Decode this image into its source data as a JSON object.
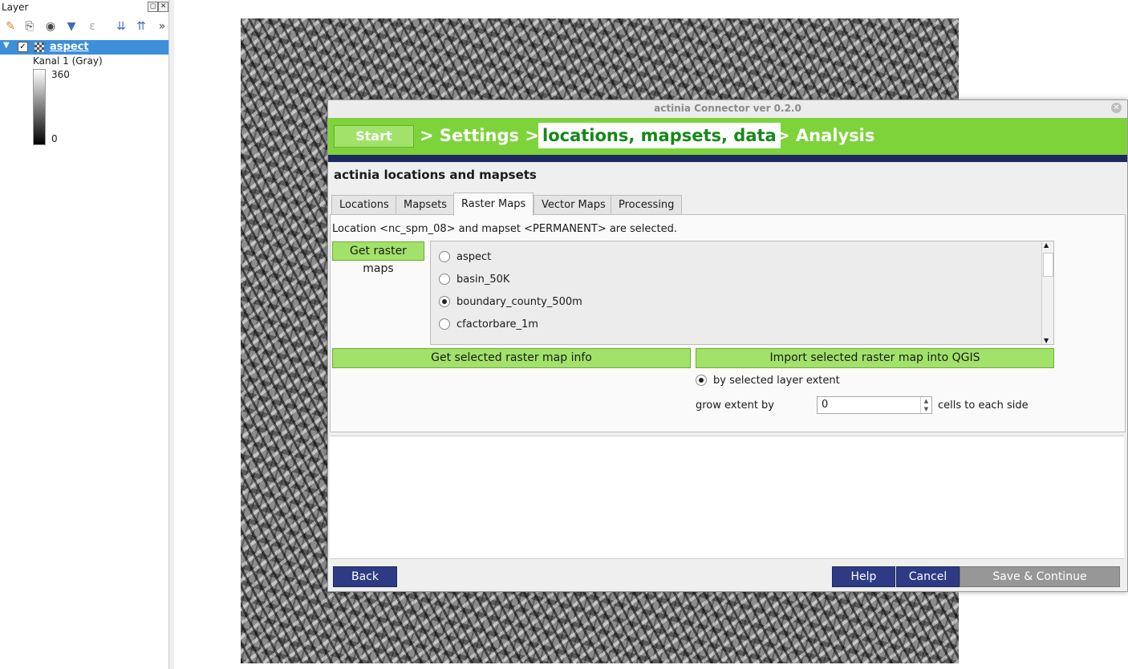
{
  "layers_panel": {
    "title": "Layer",
    "toolbar_icons": [
      "style-brush-icon",
      "add-group-icon",
      "visibility-eye-icon",
      "filter-icon",
      "expression-filter-icon",
      "expand-all-icon",
      "collapse-all-icon",
      "more-icon"
    ],
    "layer": {
      "name": "aspect",
      "checked": true
    },
    "legend": {
      "band": "Kanal 1 (Gray)",
      "max": "360",
      "min": "0"
    }
  },
  "dialog": {
    "title": "actinia Connector ver 0.2.0",
    "wizard": {
      "start": "Start",
      "settings": "> Settings >",
      "current": "locations, mapsets, data",
      "analysis": "> Analysis"
    },
    "heading": "actinia locations and mapsets",
    "tabs": [
      "Locations",
      "Mapsets",
      "Raster Maps",
      "Vector Maps",
      "Processing"
    ],
    "active_tab": "Raster Maps",
    "raster_tab": {
      "status": "Location <nc_spm_08> and mapset <PERMANENT> are selected.",
      "get_button": "Get raster maps",
      "maps": [
        {
          "name": "aspect",
          "selected": false
        },
        {
          "name": "basin_50K",
          "selected": false
        },
        {
          "name": "boundary_county_500m",
          "selected": true
        },
        {
          "name": "cfactorbare_1m",
          "selected": false
        }
      ],
      "info_button": "Get selected raster map info",
      "import_button": "Import selected raster map into QGIS",
      "extent_option": "by selected layer extent",
      "grow_label": "grow extent by",
      "grow_value": "0",
      "grow_suffix": "cells to each side"
    },
    "footer": {
      "back": "Back",
      "help": "Help",
      "cancel": "Cancel",
      "save": "Save & Continue"
    }
  },
  "colors": {
    "wizard_green": "#7ed33b",
    "button_green": "#a2e26a",
    "current_step_text": "#15881a",
    "nav_blue": "#2e3b84",
    "selected_layer": "#3d8fd9"
  }
}
